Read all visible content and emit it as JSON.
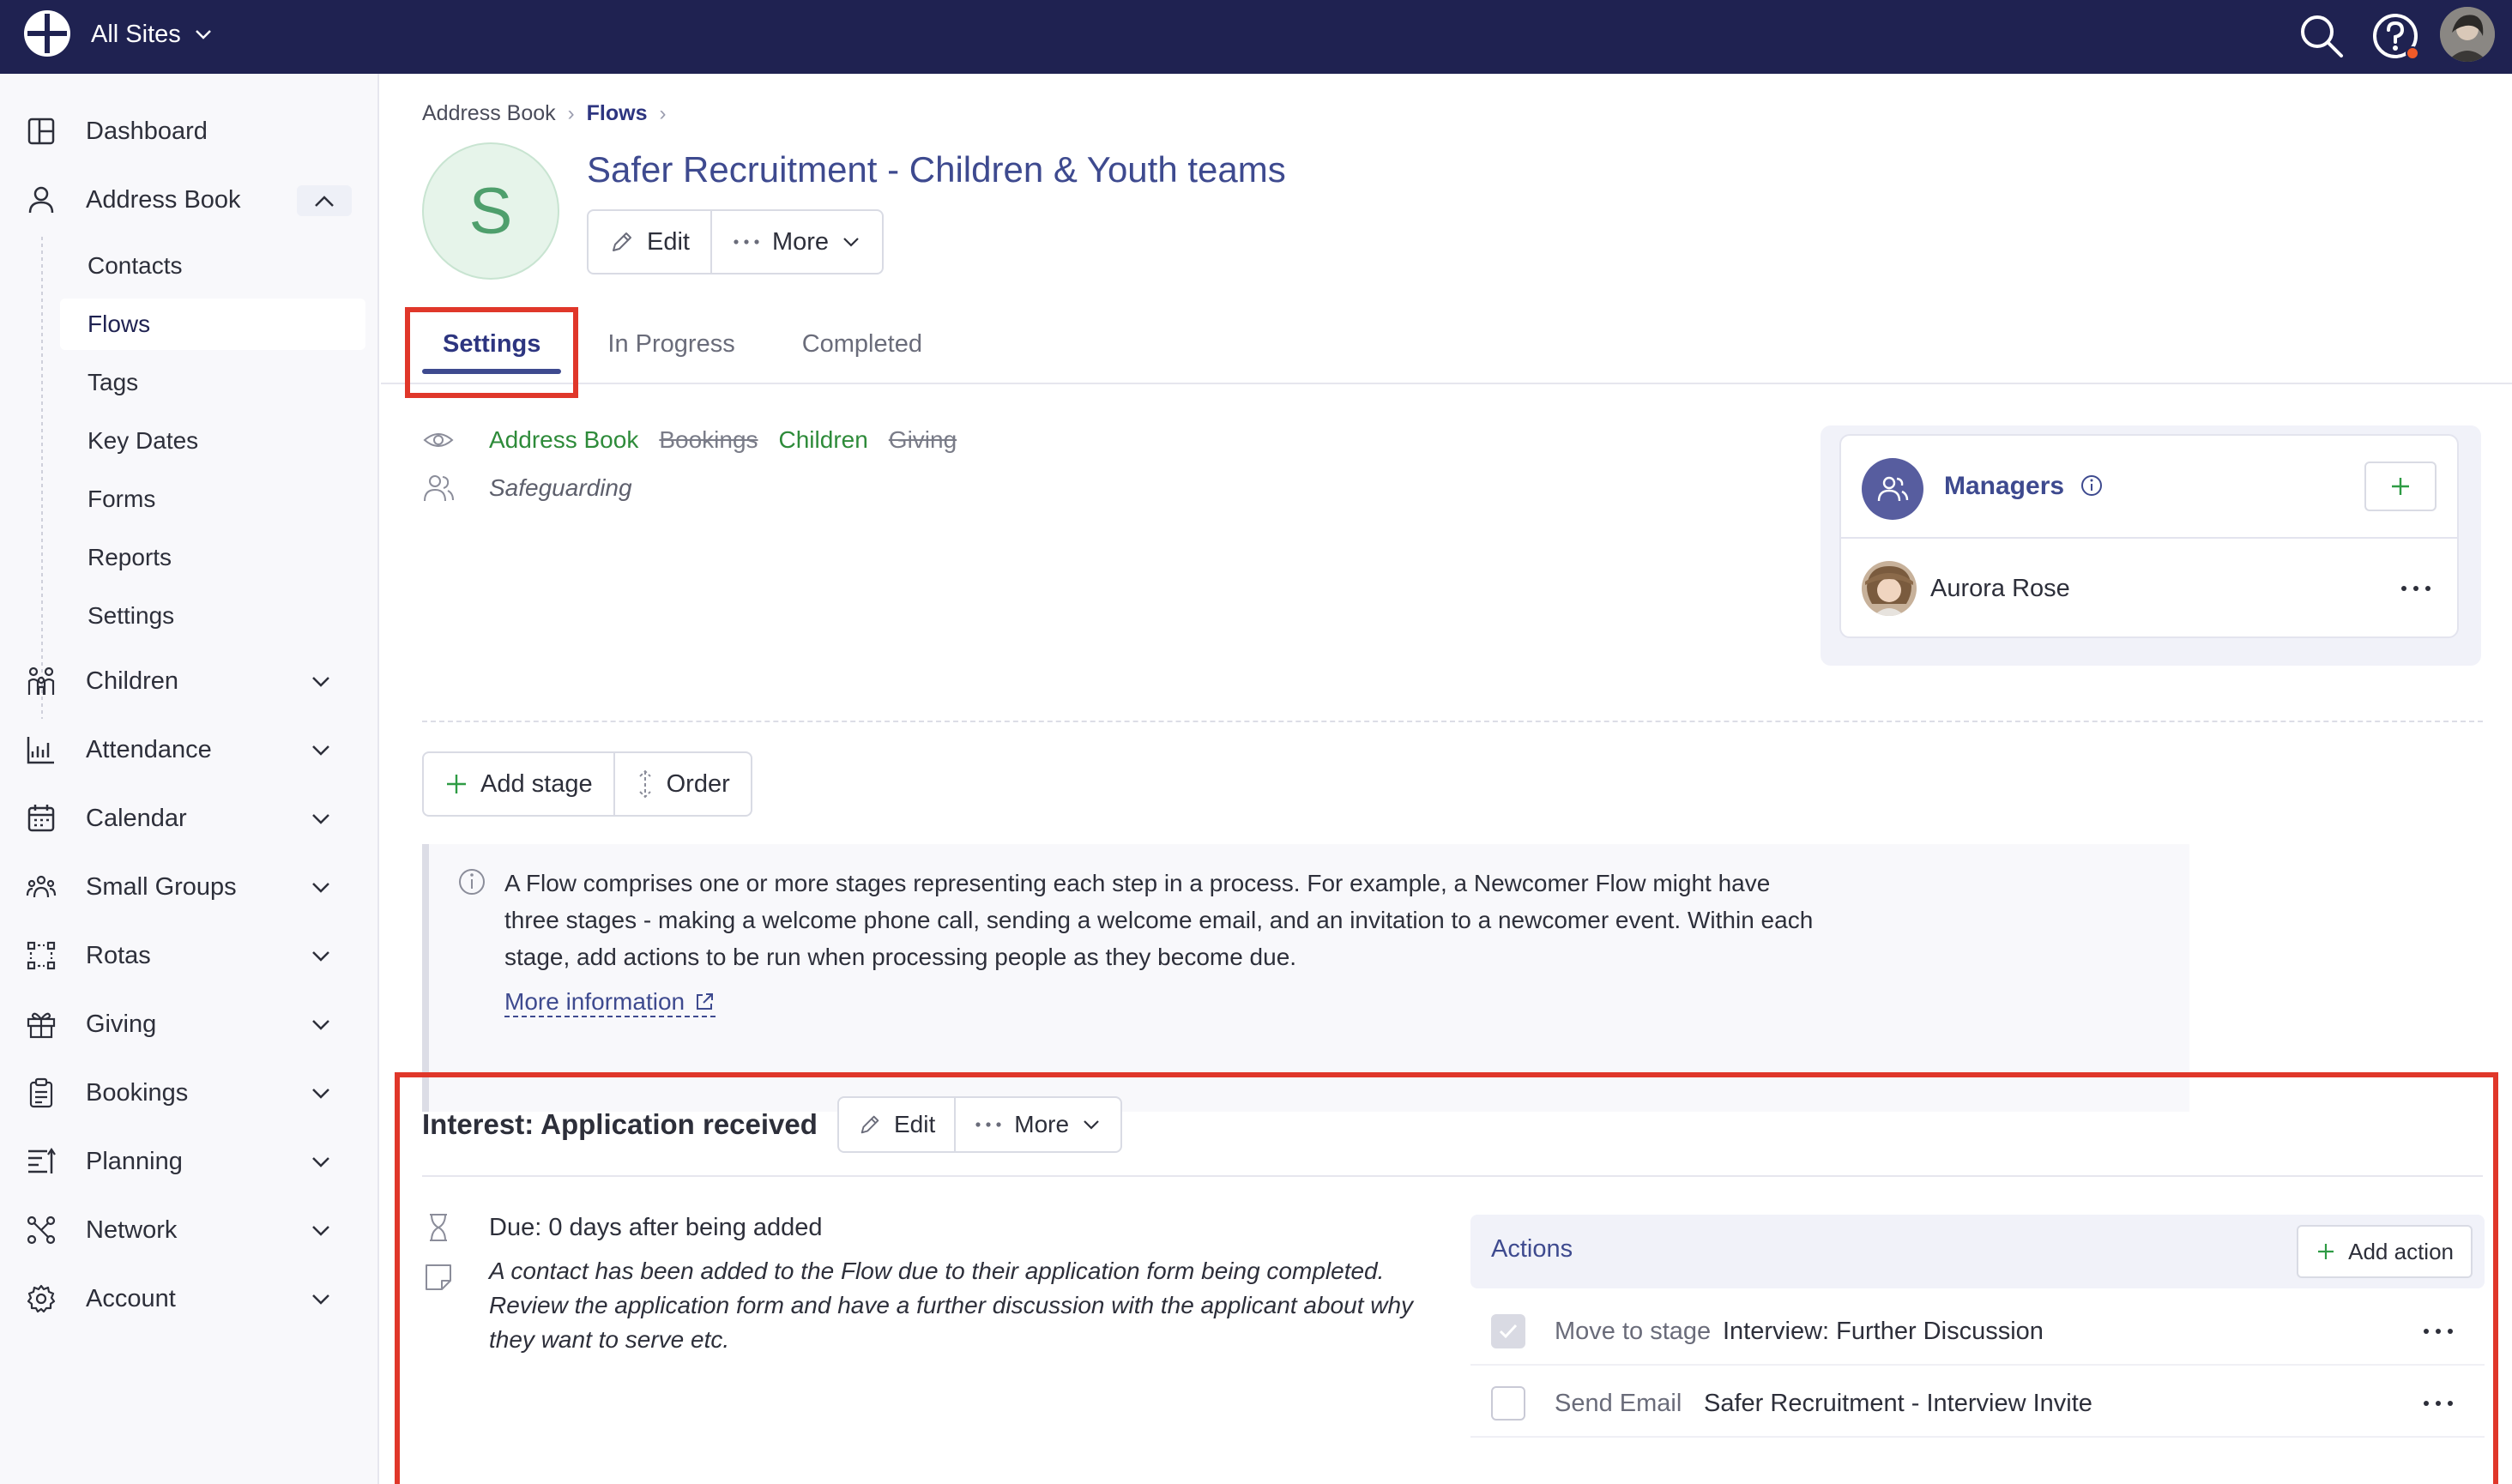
{
  "topbar": {
    "site_switch": "All Sites",
    "icons": [
      "search-icon",
      "help-icon",
      "user-avatar"
    ],
    "colors": {
      "bar": "#1f2251",
      "notify_dot": "#f05a28"
    }
  },
  "sidebar": {
    "items": [
      {
        "label": "Dashboard",
        "icon": "dashboard-icon"
      },
      {
        "label": "Address Book",
        "icon": "person-icon",
        "expanded": true
      },
      {
        "label": "Children",
        "icon": "children-icon"
      },
      {
        "label": "Attendance",
        "icon": "attendance-chart-icon"
      },
      {
        "label": "Calendar",
        "icon": "calendar-icon"
      },
      {
        "label": "Small Groups",
        "icon": "groups-icon"
      },
      {
        "label": "Rotas",
        "icon": "rotas-icon"
      },
      {
        "label": "Giving",
        "icon": "gift-icon"
      },
      {
        "label": "Bookings",
        "icon": "clipboard-icon"
      },
      {
        "label": "Planning",
        "icon": "planning-icon"
      },
      {
        "label": "Network",
        "icon": "network-icon"
      },
      {
        "label": "Account",
        "icon": "gear-icon"
      }
    ],
    "subitems": [
      "Contacts",
      "Flows",
      "Tags",
      "Key Dates",
      "Forms",
      "Reports",
      "Settings"
    ],
    "active_subitem": "Flows"
  },
  "breadcrumb": {
    "first": "Address Book",
    "second": "Flows"
  },
  "header": {
    "avatar_letter": "S",
    "title": "Safer Recruitment - Children & Youth teams",
    "edit_label": "Edit",
    "more_label": "More"
  },
  "tabs": [
    {
      "label": "Settings",
      "active": true
    },
    {
      "label": "In Progress",
      "active": false
    },
    {
      "label": "Completed",
      "active": false
    }
  ],
  "visibility_tags": [
    {
      "label": "Address Book",
      "strike": false
    },
    {
      "label": "Bookings",
      "strike": true
    },
    {
      "label": "Children",
      "strike": false
    },
    {
      "label": "Giving",
      "strike": true
    }
  ],
  "security_group": "Safeguarding",
  "managers": {
    "title": "Managers",
    "people": [
      {
        "name": "Aurora Rose"
      }
    ]
  },
  "stage_toolbar": {
    "add_stage": "Add stage",
    "order": "Order"
  },
  "info": {
    "text": "A Flow comprises one or more stages representing each step in a process. For example, a Newcomer Flow might have three stages - making a welcome phone call, sending a welcome email, and an invitation to a newcomer event. Within each stage, add actions to be run when processing people as they become due.",
    "link": "More information"
  },
  "stage": {
    "title": "Interest: Application received",
    "edit_label": "Edit",
    "more_label": "More",
    "due": "Due: 0 days after being added",
    "description": "A contact has been added to the Flow due to their application form being completed. Review the application form and have a further discussion with the applicant about why they want to serve etc.",
    "actions_title": "Actions",
    "add_action": "Add action",
    "actions": [
      {
        "kind": "Move to stage",
        "value": "Interview: Further Discussion",
        "checked": true
      },
      {
        "kind": "Send Email",
        "value": "Safer Recruitment - Interview Invite",
        "checked": false
      }
    ]
  },
  "highlight_color": "#e0372a"
}
